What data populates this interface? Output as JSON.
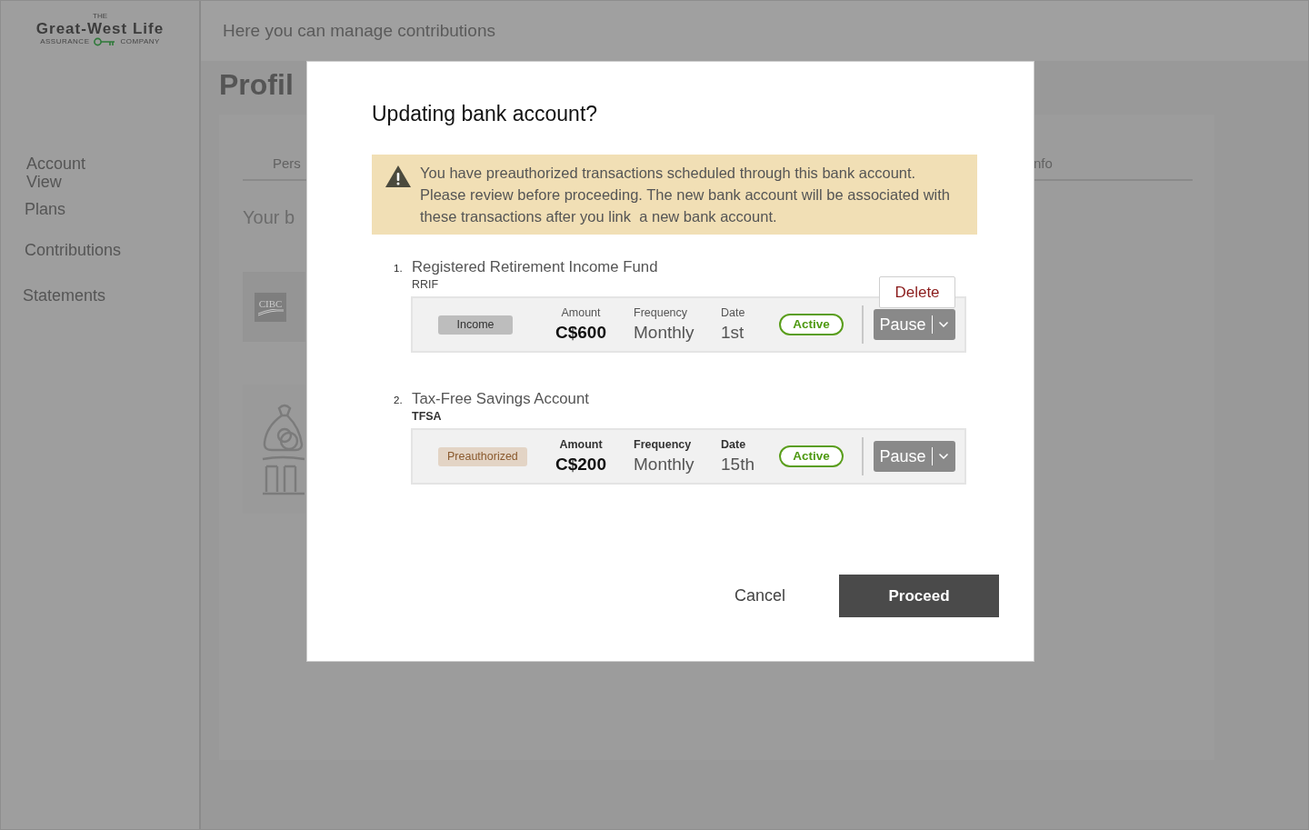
{
  "sidebar": {
    "logo": {
      "overline": "THE",
      "wordmark": "Great-West Life",
      "tagline_left": "ASSURANCE",
      "tagline_right": "COMPANY"
    },
    "nav_items": [
      {
        "label": "Account View"
      },
      {
        "label": "Plans"
      },
      {
        "label": "Contributions"
      },
      {
        "label": "Statements"
      }
    ]
  },
  "header": {
    "text": "Here you can manage contributions"
  },
  "page": {
    "title": "Profil",
    "tabs": [
      {
        "label": "Pers"
      },
      {
        "label": "nfo"
      }
    ],
    "section_title": "Your b",
    "bank_logo": "CIBC"
  },
  "dialog": {
    "title": "Updating bank account?",
    "warning": "You have preauthorized transactions scheduled through this bank account. Please review before proceeding. The new bank account will be associated with these transactions after you link  a new bank account.",
    "plans": [
      {
        "number": "1.",
        "name": "Registered Retirement Income Fund",
        "code": "RRIF",
        "labels_bold": false,
        "badge": {
          "label": "Income",
          "kind": "income"
        },
        "fields": [
          {
            "label": "Amount",
            "value": "C$600",
            "kind": "amount"
          },
          {
            "label": "Frequency",
            "value": "Monthly",
            "kind": "plain"
          },
          {
            "label": "Date",
            "value": "1st",
            "kind": "plain"
          }
        ],
        "status": {
          "label": "Active",
          "kind": "active"
        },
        "action": {
          "label": "Pause",
          "menu_open": true,
          "menu_items": [
            {
              "label": "Delete"
            }
          ]
        }
      },
      {
        "number": "2.",
        "name": "Tax-Free Savings Account",
        "code": "TFSA",
        "labels_bold": true,
        "badge": {
          "label": "Preauthorized",
          "kind": "preauthorized"
        },
        "fields": [
          {
            "label": "Amount",
            "value": "C$200",
            "kind": "amount"
          },
          {
            "label": "Frequency",
            "value": "Monthly",
            "kind": "plain"
          },
          {
            "label": "Date",
            "value": "15th",
            "kind": "plain"
          }
        ],
        "status": {
          "label": "Active",
          "kind": "active"
        },
        "action": {
          "label": "Pause",
          "menu_open": false
        }
      }
    ],
    "buttons": [
      {
        "label": "Cancel",
        "kind": "secondary"
      },
      {
        "label": "Proceed",
        "kind": "primary"
      }
    ]
  }
}
